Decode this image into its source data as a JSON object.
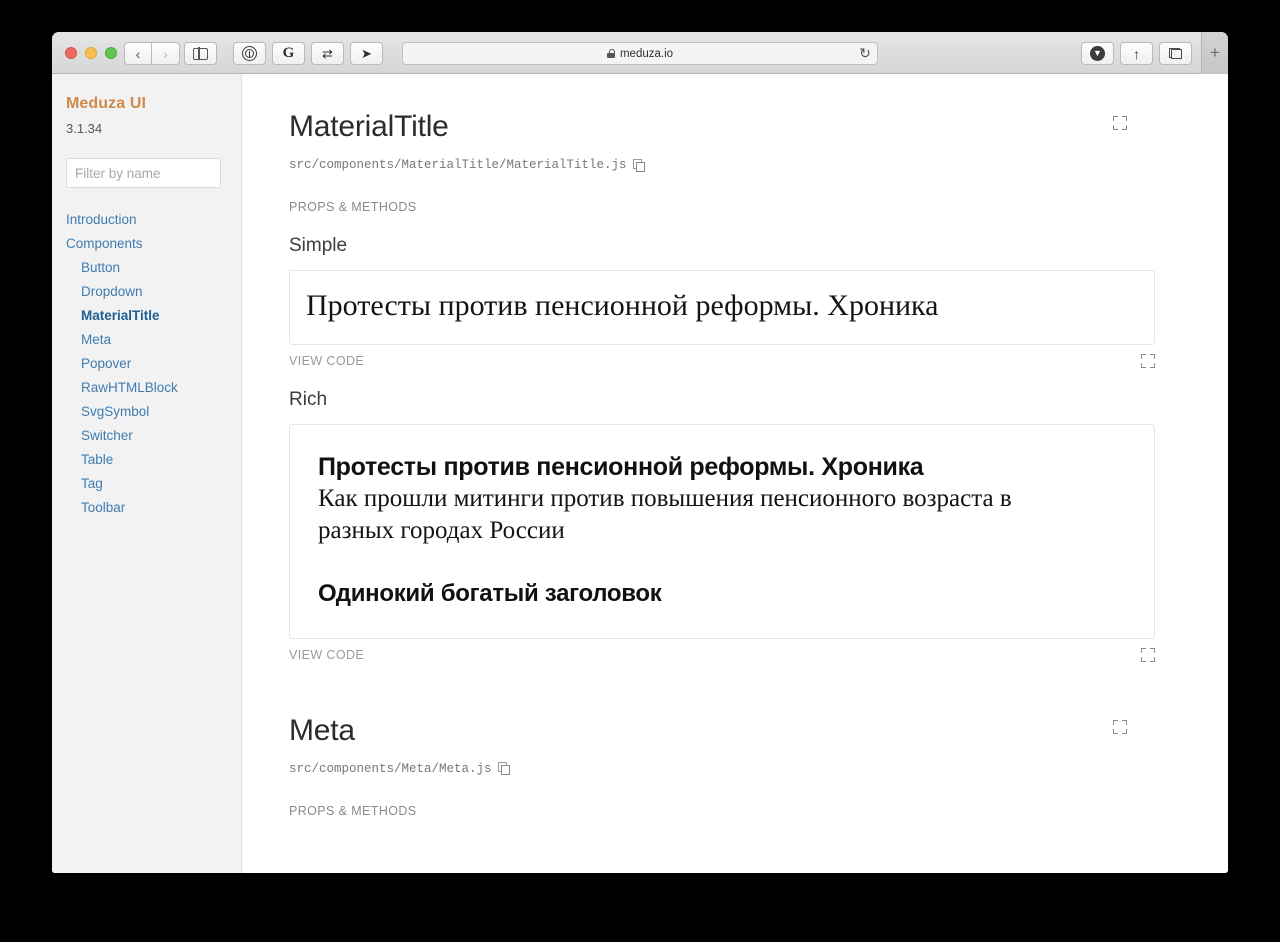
{
  "browser": {
    "url": "meduza.io",
    "lock_icon": "lock-icon",
    "back_label": "‹",
    "forward_label": "›",
    "reload_label": "↻",
    "new_tab_label": "+",
    "toolbar_extensions": [
      {
        "name": "onepassword-icon",
        "glyph": ""
      },
      {
        "name": "grammarly-icon",
        "glyph": "G"
      },
      {
        "name": "swap-arrows-icon",
        "glyph": "⇄"
      },
      {
        "name": "pin-icon",
        "glyph": "➤"
      }
    ],
    "right_buttons": [
      {
        "name": "downloads-icon",
        "glyph": "▼"
      },
      {
        "name": "share-icon",
        "glyph": "↑"
      },
      {
        "name": "tab-overview-icon",
        "glyph": ""
      }
    ]
  },
  "sidebar": {
    "title": "Meduza UI",
    "version": "3.1.34",
    "filter_placeholder": "Filter by name",
    "filter_value": "",
    "items": [
      {
        "label": "Introduction",
        "level": 0,
        "active": false
      },
      {
        "label": "Components",
        "level": 0,
        "active": false
      },
      {
        "label": "Button",
        "level": 1,
        "active": false
      },
      {
        "label": "Dropdown",
        "level": 1,
        "active": false
      },
      {
        "label": "MaterialTitle",
        "level": 1,
        "active": true
      },
      {
        "label": "Meta",
        "level": 1,
        "active": false
      },
      {
        "label": "Popover",
        "level": 1,
        "active": false
      },
      {
        "label": "RawHTMLBlock",
        "level": 1,
        "active": false
      },
      {
        "label": "SvgSymbol",
        "level": 1,
        "active": false
      },
      {
        "label": "Switcher",
        "level": 1,
        "active": false
      },
      {
        "label": "Table",
        "level": 1,
        "active": false
      },
      {
        "label": "Tag",
        "level": 1,
        "active": false
      },
      {
        "label": "Toolbar",
        "level": 1,
        "active": false
      }
    ]
  },
  "main": {
    "sections": [
      {
        "title": "MaterialTitle",
        "path": "src/components/MaterialTitle/MaterialTitle.js",
        "props_label": "PROPS & METHODS",
        "examples": [
          {
            "name": "Simple",
            "view_code_label": "VIEW CODE",
            "simple_text": "Протесты против пенсионной реформы. Хроника"
          },
          {
            "name": "Rich",
            "view_code_label": "VIEW CODE",
            "rich_headline": "Протесты против пенсионной реформы. Хроника",
            "rich_subtitle": "Как прошли митинги против повышения пенсионного возраста в разных городах России",
            "rich_lone": "Одинокий богатый заголовок"
          }
        ]
      },
      {
        "title": "Meta",
        "path": "src/components/Meta/Meta.js",
        "props_label": "PROPS & METHODS"
      }
    ]
  },
  "colors": {
    "brand": "#d08a4d",
    "link": "#3e7cb1",
    "active_link": "#1d6091",
    "sidebar_bg": "#f2f2f2"
  }
}
